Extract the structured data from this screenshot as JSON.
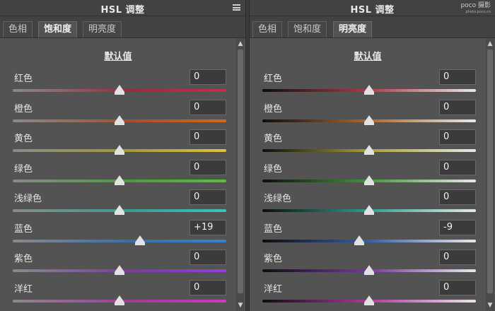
{
  "left_panel": {
    "title": "HSL 调整",
    "tabs": [
      {
        "label": "色相",
        "active": false
      },
      {
        "label": "饱和度",
        "active": true
      },
      {
        "label": "明亮度",
        "active": false
      }
    ],
    "default_label": "默认值",
    "rows": [
      {
        "label": "红色",
        "value": "0",
        "level": 0.5,
        "track": "#9d2a3e",
        "end": "#c0314a"
      },
      {
        "label": "橙色",
        "value": "0",
        "level": 0.5,
        "track": "#a2512c",
        "end": "#d0681f"
      },
      {
        "label": "黄色",
        "value": "0",
        "level": 0.5,
        "track": "#a49a3a",
        "end": "#d8c73a"
      },
      {
        "label": "绿色",
        "value": "0",
        "level": 0.5,
        "track": "#4c9b3c",
        "end": "#58c23a"
      },
      {
        "label": "浅绿色",
        "value": "0",
        "level": 0.5,
        "track": "#3b9c90",
        "end": "#39c6b3"
      },
      {
        "label": "蓝色",
        "value": "+19",
        "level": 0.595,
        "track": "#3a6eaa",
        "end": "#3a7fd6"
      },
      {
        "label": "紫色",
        "value": "0",
        "level": 0.5,
        "track": "#7a3aa8",
        "end": "#9a3bd8"
      },
      {
        "label": "洋红",
        "value": "0",
        "level": 0.5,
        "track": "#a23a9a",
        "end": "#cc3ac0"
      }
    ]
  },
  "right_panel": {
    "title": "HSL 调整",
    "watermark": "poco 摄影",
    "watermark_sub": "photo.poco.cn",
    "tabs": [
      {
        "label": "色相",
        "active": false
      },
      {
        "label": "饱和度",
        "active": false
      },
      {
        "label": "明亮度",
        "active": true
      }
    ],
    "default_label": "默认值",
    "rows": [
      {
        "label": "红色",
        "value": "0",
        "level": 0.5,
        "track": "#b33a48"
      },
      {
        "label": "橙色",
        "value": "0",
        "level": 0.5,
        "track": "#b0682c"
      },
      {
        "label": "黄色",
        "value": "0",
        "level": 0.5,
        "track": "#a8a035"
      },
      {
        "label": "绿色",
        "value": "0",
        "level": 0.5,
        "track": "#3f9a35"
      },
      {
        "label": "浅绿色",
        "value": "0",
        "level": 0.5,
        "track": "#2f9f8f"
      },
      {
        "label": "蓝色",
        "value": "-9",
        "level": 0.455,
        "track": "#3a5fa8"
      },
      {
        "label": "紫色",
        "value": "0",
        "level": 0.5,
        "track": "#7a36a8"
      },
      {
        "label": "洋红",
        "value": "0",
        "level": 0.5,
        "track": "#b0389f"
      }
    ]
  },
  "icons": {
    "menu": "panel-menu-icon",
    "scroll_up": "scroll-up-icon",
    "scroll_down": "scroll-down-icon"
  }
}
